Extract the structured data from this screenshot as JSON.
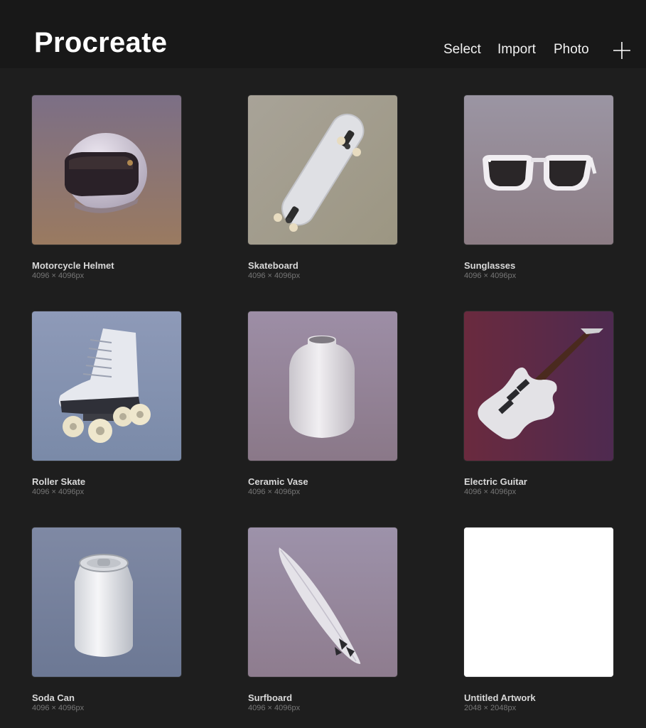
{
  "header": {
    "title": "Procreate",
    "actions": {
      "select": "Select",
      "import": "Import",
      "photo": "Photo"
    },
    "add_icon": "plus-icon"
  },
  "gallery": {
    "items": [
      {
        "title": "Motorcycle Helmet",
        "size": "4096 × 4096px",
        "thumbnail": "motorcycle-helmet"
      },
      {
        "title": "Skateboard",
        "size": "4096 × 4096px",
        "thumbnail": "skateboard"
      },
      {
        "title": "Sunglasses",
        "size": "4096 × 4096px",
        "thumbnail": "sunglasses"
      },
      {
        "title": "Roller Skate",
        "size": "4096 × 4096px",
        "thumbnail": "roller-skate"
      },
      {
        "title": "Ceramic Vase",
        "size": "4096 × 4096px",
        "thumbnail": "ceramic-vase"
      },
      {
        "title": "Electric Guitar",
        "size": "4096 × 4096px",
        "thumbnail": "electric-guitar"
      },
      {
        "title": "Soda Can",
        "size": "4096 × 4096px",
        "thumbnail": "soda-can"
      },
      {
        "title": "Surfboard",
        "size": "4096 × 4096px",
        "thumbnail": "surfboard"
      },
      {
        "title": "Untitled Artwork",
        "size": "2048 × 2048px",
        "thumbnail": "blank-canvas"
      }
    ]
  },
  "colors": {
    "background": "#1e1e1e",
    "header_background": "#181818",
    "title_text": "#ffffff",
    "caption_text": "#d9d9d9",
    "subcaption_text": "#777777"
  }
}
